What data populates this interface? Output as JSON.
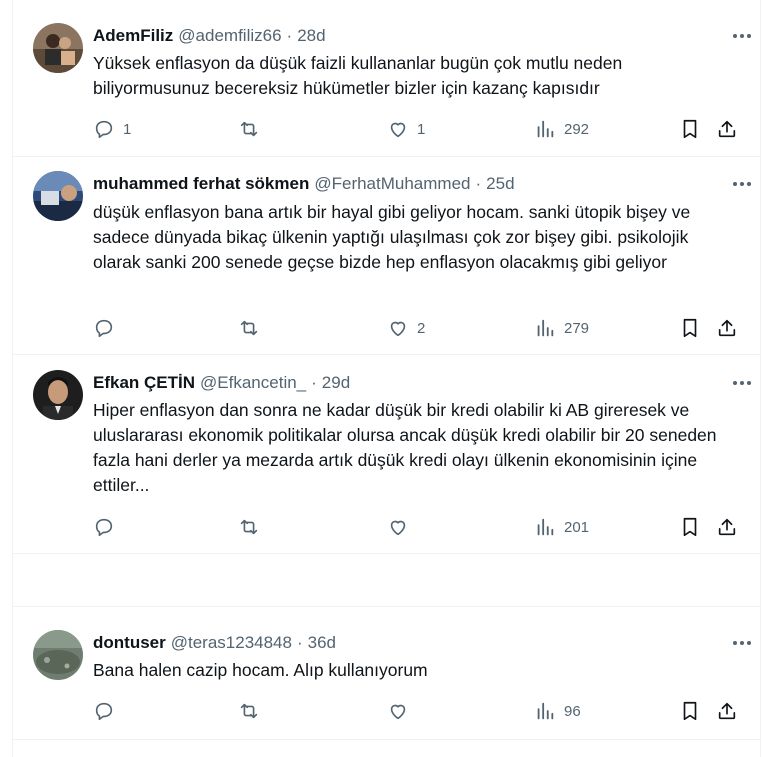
{
  "tweets": [
    {
      "name": "AdemFiliz",
      "handle": "@ademfiliz66",
      "date": "28d",
      "text": "Yüksek enflasyon da düşük faizli kullananlar bugün çok mutlu neden biliyormusunuz becereksiz hükümetler bizler için kazanç kapısıdır",
      "replies": "1",
      "retweets": "",
      "likes": "1",
      "views": "292",
      "avatar_colors": [
        "#a08870",
        "#5a4a3a"
      ]
    },
    {
      "name": "muhammed ferhat sökmen",
      "handle": "@FerhatMuhammed",
      "date": "25d",
      "text": "düşük enflasyon bana artık bir hayal gibi geliyor hocam.  sanki ütopik bişey ve sadece dünyada bikaç ülkenin yaptığı ulaşılması çok zor bişey gibi. psikolojik olarak sanki 200 senede geçse bizde hep enflasyon olacakmış gibi geliyor",
      "replies": "",
      "retweets": "",
      "likes": "2",
      "views": "279",
      "avatar_colors": [
        "#3a5a8a",
        "#1a2a4a"
      ]
    },
    {
      "name": "Efkan ÇETİN",
      "handle": "@Efkancetin_",
      "date": "29d",
      "text": "Hiper enflasyon dan sonra ne kadar düşük bir kredi olabilir ki AB gireresek ve uluslararası ekonomik politikalar olursa ancak düşük kredi olabilir bir 20 seneden fazla hani derler ya mezarda artık düşük kredi olayı ülkenin ekonomisinin içine ettiler...",
      "replies": "",
      "retweets": "",
      "likes": "",
      "views": "201",
      "avatar_colors": [
        "#2a2a2a",
        "#c9a88a"
      ]
    },
    {
      "name": "dontuser",
      "handle": "@teras1234848",
      "date": "36d",
      "text": "Bana halen cazip hocam. Alıp kullanıyorum",
      "replies": "",
      "retweets": "",
      "likes": "",
      "views": "96",
      "avatar_colors": [
        "#7a8a7a",
        "#4a5a4a"
      ]
    }
  ],
  "separator_dot": "·",
  "icons": {
    "reply": "reply-icon",
    "retweet": "retweet-icon",
    "like": "heart-icon",
    "views": "views-icon",
    "bookmark": "bookmark-icon",
    "share": "share-icon",
    "more": "more-icon"
  },
  "colors": {
    "text": "#0f1419",
    "secondary": "#536471",
    "border": "#eff3f4"
  }
}
